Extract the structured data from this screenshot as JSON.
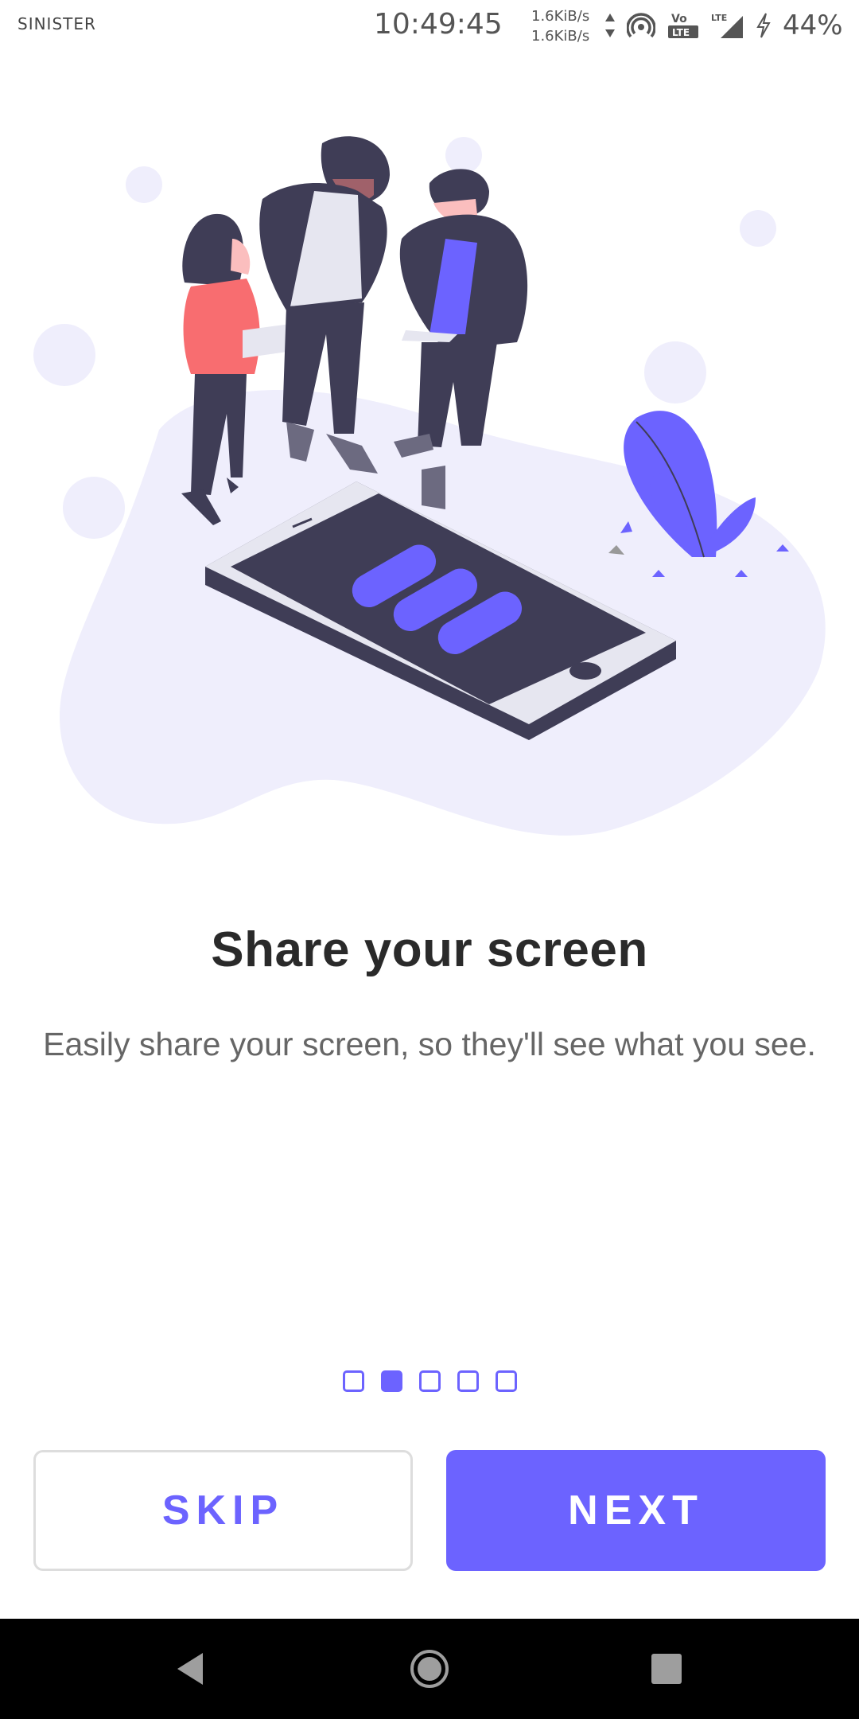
{
  "status_bar": {
    "carrier": "SINISTER",
    "time": "10:49:45",
    "net_up": "1.6KiB/s",
    "net_down": "1.6KiB/s",
    "network_badge": "LTE",
    "volte_badge": "Vo LTE",
    "battery": "44%"
  },
  "onboarding": {
    "title": "Share your screen",
    "description": "Easily share your screen, so they'll see what you see.",
    "pages_total": 5,
    "active_page": 2
  },
  "buttons": {
    "skip_label": "SKIP",
    "next_label": "NEXT"
  },
  "colors": {
    "accent": "#6c63ff",
    "blob": "#efeefc",
    "dark": "#3f3d56"
  },
  "icons": {
    "status": [
      "hotspot-icon",
      "volte-icon",
      "signal-icon",
      "charging-icon"
    ],
    "nav": [
      "back-icon",
      "home-icon",
      "recents-icon"
    ]
  }
}
